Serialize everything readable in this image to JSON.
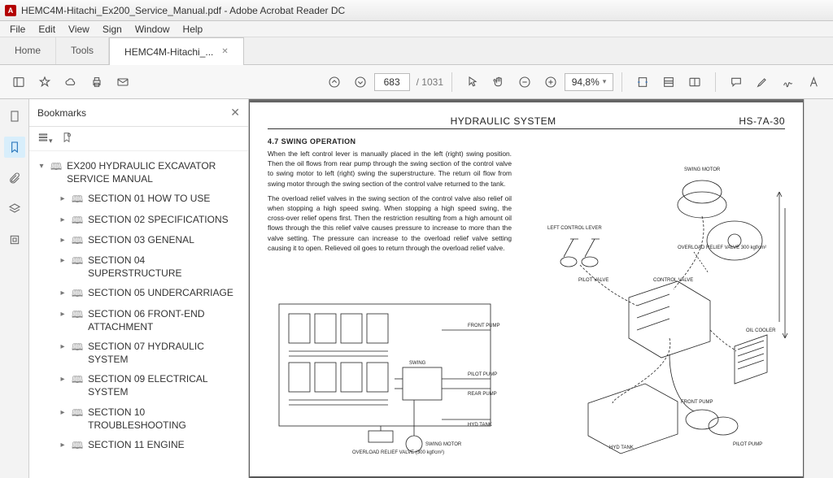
{
  "window": {
    "title": "HEMC4M-Hitachi_Ex200_Service_Manual.pdf - Adobe Acrobat Reader DC"
  },
  "menu": {
    "file": "File",
    "edit": "Edit",
    "view": "View",
    "sign": "Sign",
    "window": "Window",
    "help": "Help"
  },
  "doctabs": {
    "home": "Home",
    "tools": "Tools",
    "active": "HEMC4M-Hitachi_..."
  },
  "toolbar": {
    "page_current": "683",
    "page_total": "/ 1031",
    "zoom": "94,8%"
  },
  "bookmarks": {
    "title": "Bookmarks",
    "root": "EX200 HYDRAULIC EXCAVATOR SERVICE MANUAL",
    "items": [
      "SECTION 01 HOW TO USE",
      "SECTION 02 SPECIFICATIONS",
      "SECTION 03 GENENAL",
      "SECTION 04 SUPERSTRUCTURE",
      "SECTION 05 UNDERCARRIAGE",
      "SECTION 06 FRONT-END ATTACHMENT",
      "SECTION 07 HYDRAULIC SYSTEM",
      "SECTION 09 ELECTRICAL SYSTEM",
      "SECTION 10 TROUBLESHOOTING",
      "SECTION 11 ENGINE"
    ]
  },
  "page": {
    "header_center": "HYDRAULIC SYSTEM",
    "header_right": "HS-7A-30",
    "section": "4.7 SWING OPERATION",
    "para1": "When the left control lever is manually placed in the left (right) swing position. Then the oil flows from rear pump through the swing section of the control valve to swing motor to left (right) swing the superstructure. The return oil flow from swing motor through the swing section of the control valve returned to the tank.",
    "para2": "The overload relief valves in the swing section of the control valve also relief oil when stopping a high speed swing. When stopping a high speed swing, the cross-over relief opens first. Then the restriction resulting from a high amount oil flows through the this relief valve causes pressure to increase to more than the valve setting. The pressure can increase to the overload relief valve setting causing it to open. Relieved oil goes to return through the overload relief valve.",
    "labels": {
      "swing_motor": "SWING MOTOR",
      "control_valve": "CONTROL VALVE",
      "left_lever": "LEFT CONTROL LEVER",
      "pilot_pump": "PILOT PUMP",
      "front_pump": "FRONT PUMP",
      "rear_pump": "REAR PUMP",
      "hyd_tank": "HYD TANK",
      "oil_cooler": "OIL COOLER",
      "overload_relief": "OVERLOAD RELIEF VALVE (300 kgf/cm²)",
      "swing": "SWING",
      "overload2": "OVERLOAD RELIEF VALVE 300 kgf/cm²",
      "pilot_valve": "PILOT VALVE"
    }
  }
}
